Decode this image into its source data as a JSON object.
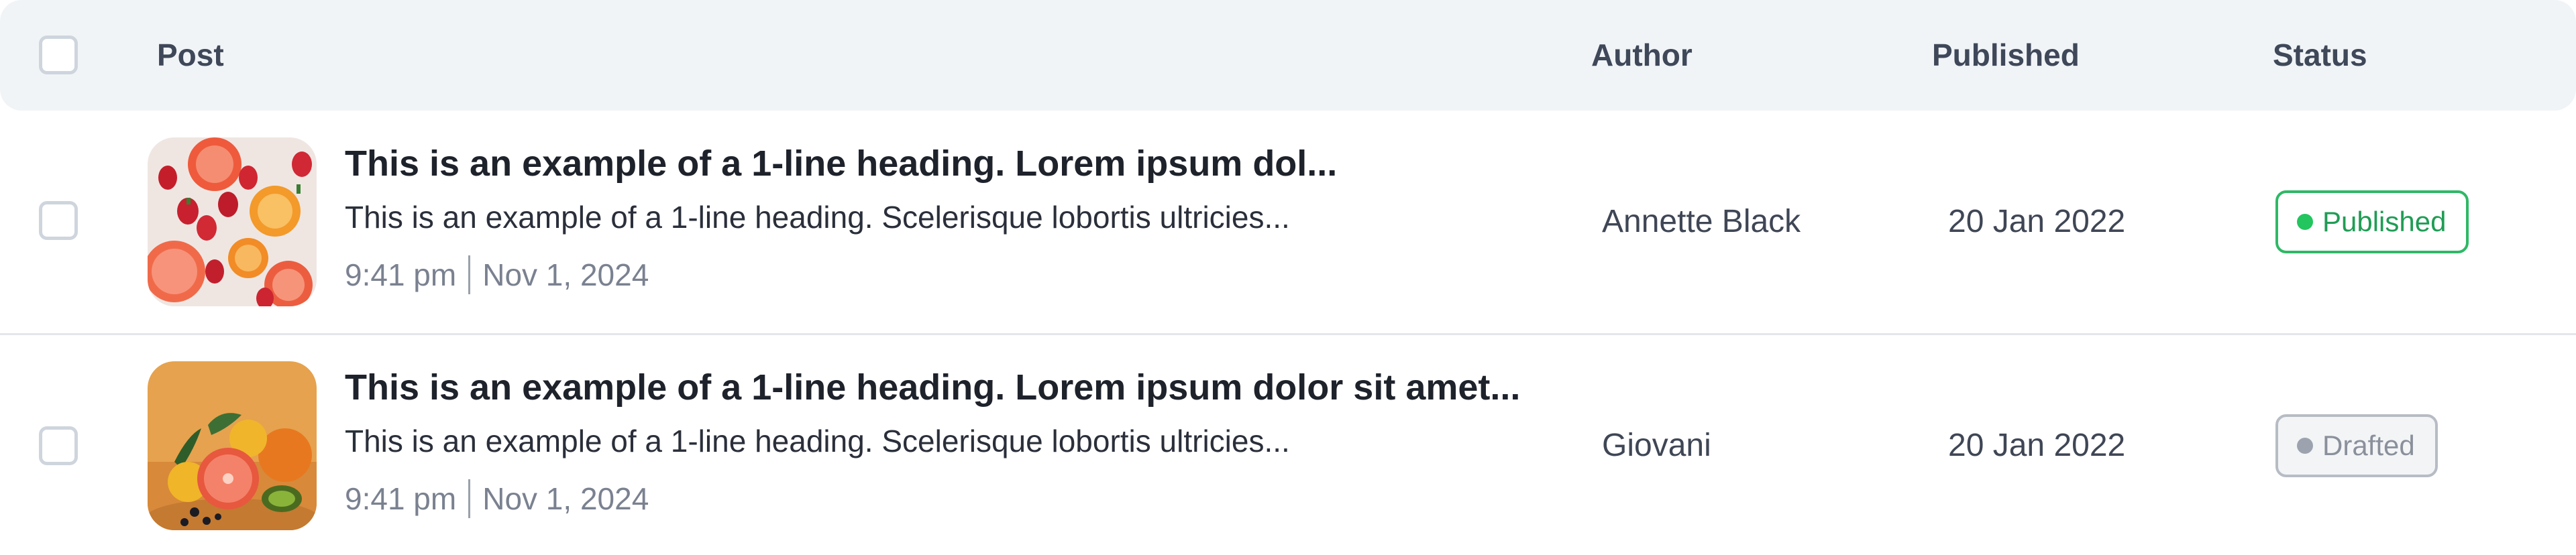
{
  "header": {
    "post": "Post",
    "author": "Author",
    "published": "Published",
    "status": "Status"
  },
  "rows": [
    {
      "title": "This is an example of a 1-line heading. Lorem ipsum dol...",
      "description": "This is an example of a 1-line heading. Scelerisque lobortis ultricies...",
      "time": "9:41 pm",
      "date": "Nov 1, 2024",
      "author": "Annette Black",
      "published": "20 Jan 2022",
      "status": "Published",
      "status_color": "#22c55e"
    },
    {
      "title": "This is an example of a 1-line heading. Lorem ipsum dolor sit amet...",
      "description": "This is an example of a 1-line heading. Scelerisque lobortis ultricies...",
      "time": "9:41 pm",
      "date": "Nov 1, 2024",
      "author": "Giovani",
      "published": "20 Jan 2022",
      "status": "Drafted",
      "status_color": "#9ca3af"
    }
  ]
}
